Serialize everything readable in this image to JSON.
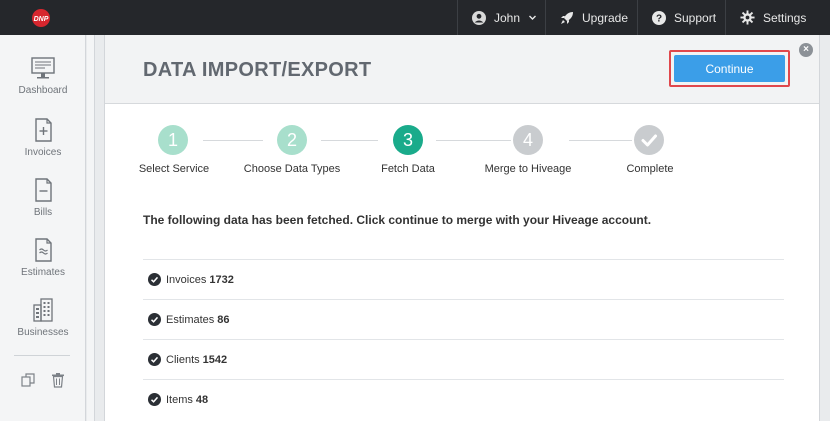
{
  "topbar": {
    "user": "John",
    "upgrade": "Upgrade",
    "support": "Support",
    "settings": "Settings"
  },
  "sidebar": {
    "items": [
      {
        "label": "Dashboard",
        "icon": "monitor-icon"
      },
      {
        "label": "Invoices",
        "icon": "invoice-icon"
      },
      {
        "label": "Bills",
        "icon": "bill-icon"
      },
      {
        "label": "Estimates",
        "icon": "estimate-icon"
      },
      {
        "label": "Businesses",
        "icon": "building-icon"
      }
    ]
  },
  "modal": {
    "title": "DATA IMPORT/EXPORT",
    "continue_label": "Continue",
    "close_symbol": "×",
    "steps": [
      {
        "number": "1",
        "label": "Select Service",
        "state": "done",
        "color": "#a8dfcc"
      },
      {
        "number": "2",
        "label": "Choose Data Types",
        "state": "done",
        "color": "#a8dfcc"
      },
      {
        "number": "3",
        "label": "Fetch Data",
        "state": "current",
        "color": "#1aab8b"
      },
      {
        "number": "4",
        "label": "Merge to Hiveage",
        "state": "pending",
        "color": "#c9cccf"
      },
      {
        "number": "",
        "label": "Complete",
        "state": "pending",
        "color": "#c9cccf"
      }
    ],
    "message": "The following data has been fetched. Click continue to merge with your Hiveage account.",
    "fetched": [
      {
        "label": "Invoices",
        "count": "1732"
      },
      {
        "label": "Estimates",
        "count": "86"
      },
      {
        "label": "Clients",
        "count": "1542"
      },
      {
        "label": "Items",
        "count": "48"
      }
    ]
  }
}
